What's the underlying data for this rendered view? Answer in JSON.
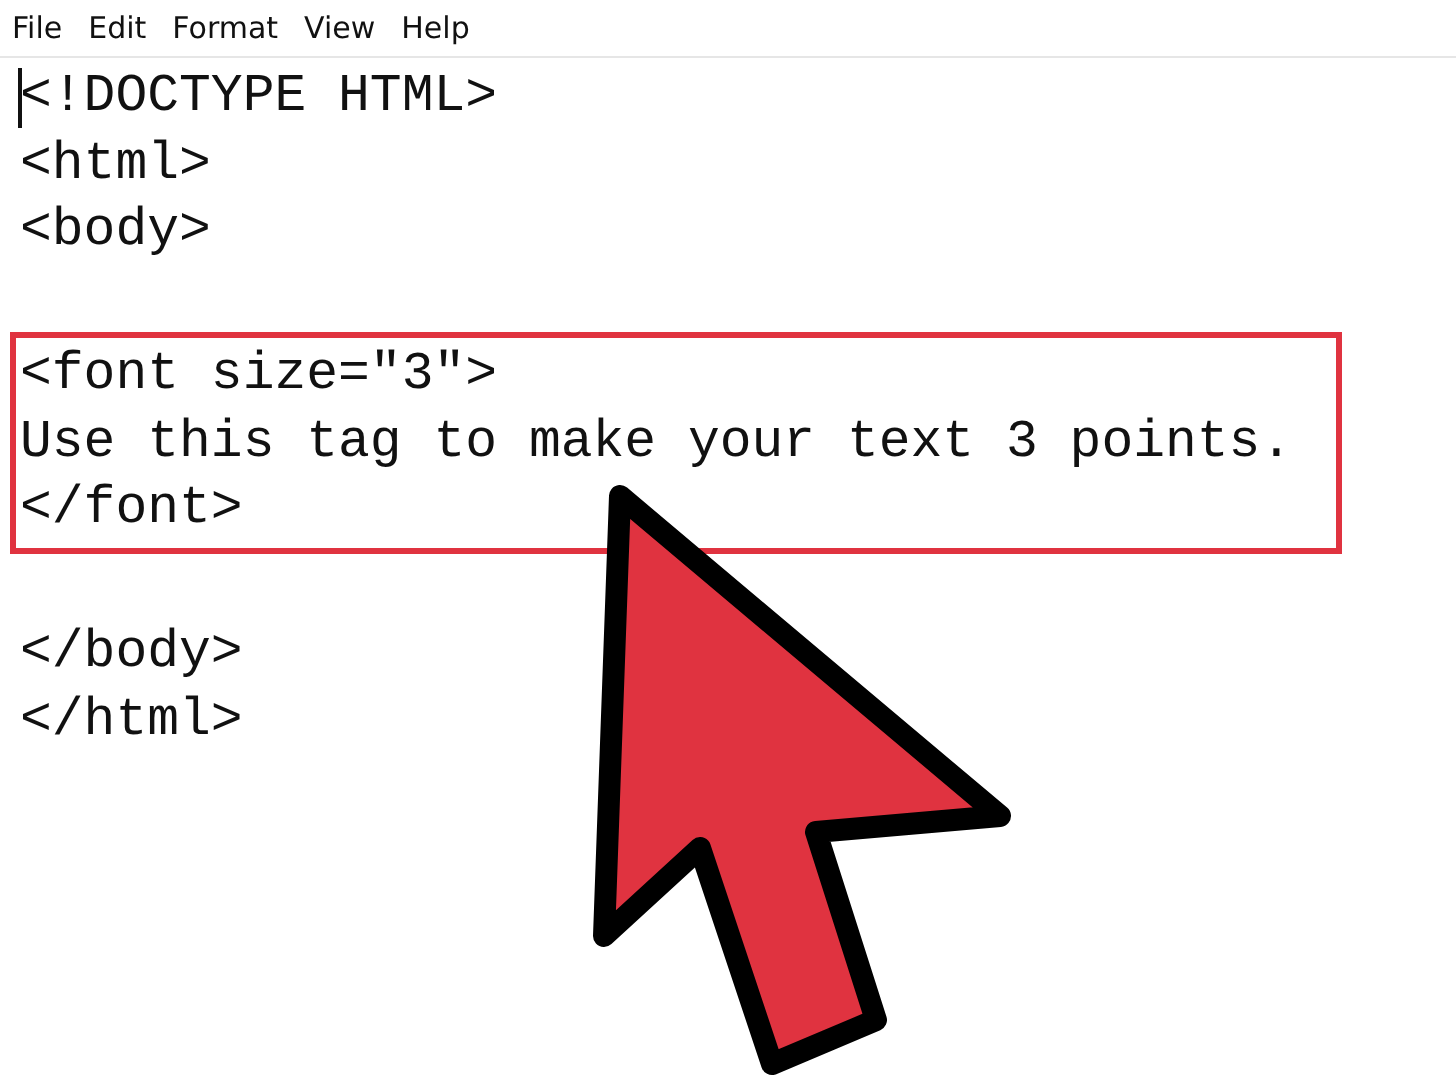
{
  "menu_bar": {
    "items": [
      "File",
      "Edit",
      "Format",
      "View",
      "Help"
    ]
  },
  "editor": {
    "lines": [
      {
        "kind": "code",
        "text": "<!DOCTYPE HTML>",
        "highlighted": false
      },
      {
        "kind": "code",
        "text": "<html>",
        "highlighted": false
      },
      {
        "kind": "code",
        "text": "<body>",
        "highlighted": false
      },
      {
        "kind": "blank"
      },
      {
        "kind": "code",
        "text": "<font size=\"3\">",
        "highlighted": true
      },
      {
        "kind": "code",
        "text": "Use this tag to make your text 3 points.",
        "highlighted": true
      },
      {
        "kind": "code",
        "text": "</font>",
        "highlighted": true
      },
      {
        "kind": "blank"
      },
      {
        "kind": "code",
        "text": "</body>",
        "highlighted": false
      },
      {
        "kind": "code",
        "text": "</html>",
        "highlighted": false
      }
    ]
  }
}
